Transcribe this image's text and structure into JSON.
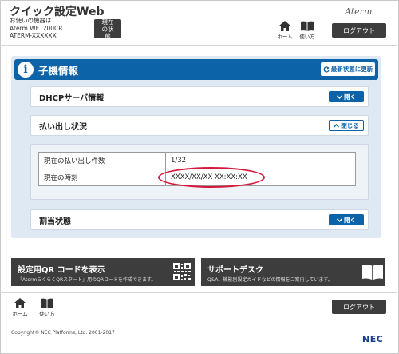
{
  "header": {
    "app_title": "クイック設定Web",
    "device_caption": "お使いの機器は",
    "model": "Aterm WF1200CR",
    "serial": "ATERM-XXXXXX",
    "status_button": "現在の状態",
    "brand_logo": "Aterm",
    "home_label": "ホーム",
    "help_label": "使い方",
    "logout_label": "ログアウト"
  },
  "section": {
    "title": "子機情報",
    "refresh_label": "最新状態に更新"
  },
  "accordions": [
    {
      "label": "DHCPサーバ情報",
      "button": "開く"
    },
    {
      "label": "払い出し状況",
      "button": "閉じる"
    },
    {
      "label": "割当状態",
      "button": "開く"
    }
  ],
  "lease_table": {
    "rows": [
      {
        "key": "現在の払い出し件数",
        "value": "1/32"
      },
      {
        "key": "現在の時刻",
        "value": "XXXX/XX/XX XX:XX:XX"
      }
    ]
  },
  "cards": {
    "qr": {
      "title": "設定用QR コードを表示",
      "subtitle": "「AtermらくらくQRスタート」用のQRコードを作成できます。"
    },
    "support": {
      "title": "サポートデスク",
      "subtitle": "Q&A、機能別設定ガイドなどの情報をご案内しています。"
    }
  },
  "footer": {
    "home_label": "ホーム",
    "help_label": "使い方",
    "logout_label": "ログアウト",
    "copyright": "Copyright© NEC Platforms, Ltd. 2001-2017",
    "company_logo": "NEC"
  },
  "colors": {
    "accent": "#0d63a8",
    "dark_button": "#3d3d3d",
    "highlight": "#d6183c",
    "panel": "#dfe9f4"
  }
}
